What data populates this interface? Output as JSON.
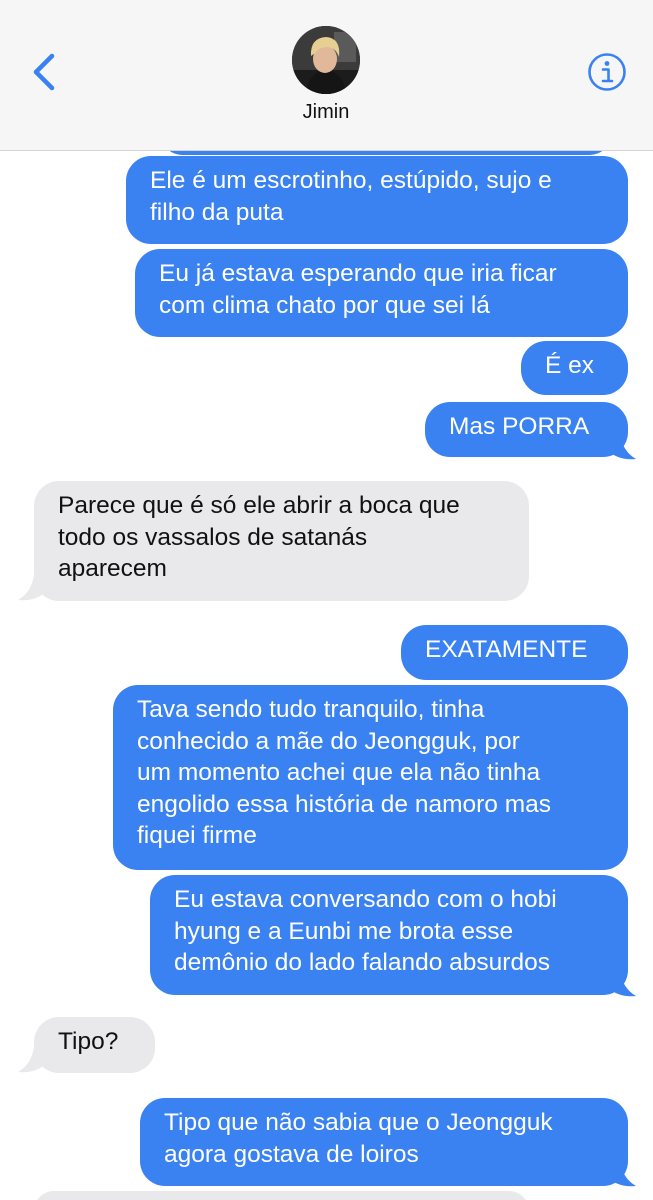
{
  "header": {
    "contact_name": "Jimin",
    "back_icon": "chevron-left-icon",
    "info_icon": "info-circle-icon",
    "accent_color": "#3a82f2"
  },
  "messages": [
    {
      "direction": "outgoing",
      "lines": [
        "Ele é um escrotinho, estúpido, sujo e",
        "filho da puta"
      ]
    },
    {
      "direction": "outgoing",
      "lines": [
        "Eu já estava esperando que iria ficar",
        "com clima chato por que sei lá"
      ]
    },
    {
      "direction": "outgoing",
      "lines": [
        "É ex"
      ]
    },
    {
      "direction": "outgoing",
      "lines": [
        "Mas PORRA"
      ]
    },
    {
      "direction": "incoming",
      "lines": [
        "Parece que é só ele abrir a boca que",
        "todo os vassalos de satanás",
        "aparecem"
      ]
    },
    {
      "direction": "outgoing",
      "lines": [
        "EXATAMENTE"
      ]
    },
    {
      "direction": "outgoing",
      "lines": [
        "Tava sendo tudo tranquilo, tinha",
        "conhecido a mãe do Jeongguk, por",
        "um momento achei que ela não tinha",
        "engolido essa história de namoro mas",
        "fiquei firme"
      ]
    },
    {
      "direction": "outgoing",
      "lines": [
        "Eu estava conversando com o hobi",
        "hyung e a Eunbi me brota esse",
        "demônio do lado falando absurdos"
      ]
    },
    {
      "direction": "incoming",
      "lines": [
        "Tipo?"
      ]
    },
    {
      "direction": "outgoing",
      "lines": [
        "Tipo que não sabia que o Jeongguk",
        "agora gostava de loiros"
      ]
    }
  ],
  "colors": {
    "outgoing_bubble": "#3a82f2",
    "incoming_bubble": "#e9e9eb",
    "header_bg": "#f6f6f6"
  }
}
